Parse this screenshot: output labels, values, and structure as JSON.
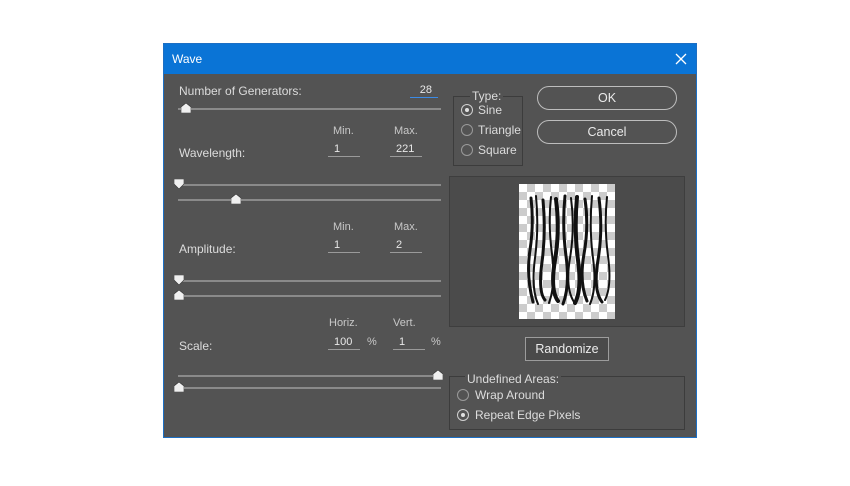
{
  "title": "Wave",
  "generators": {
    "label": "Number of Generators:",
    "value": "28"
  },
  "wavelength": {
    "label": "Wavelength:",
    "min_header": "Min.",
    "max_header": "Max.",
    "min": "1",
    "max": "221"
  },
  "amplitude": {
    "label": "Amplitude:",
    "min_header": "Min.",
    "max_header": "Max.",
    "min": "1",
    "max": "2"
  },
  "scale": {
    "label": "Scale:",
    "horiz_header": "Horiz.",
    "vert_header": "Vert.",
    "horiz": "100",
    "vert": "1",
    "unit": "%"
  },
  "type": {
    "legend": "Type:",
    "options": [
      "Sine",
      "Triangle",
      "Square"
    ],
    "selected": "Sine"
  },
  "buttons": {
    "ok": "OK",
    "cancel": "Cancel",
    "randomize": "Randomize"
  },
  "undefined_areas": {
    "legend": "Undefined Areas:",
    "options": [
      "Wrap Around",
      "Repeat Edge Pixels"
    ],
    "selected": "Repeat Edge Pixels"
  },
  "colors": {
    "titlebar": "#0a74d6",
    "dialog_bg": "#535353",
    "focus": "#3b8be6"
  }
}
